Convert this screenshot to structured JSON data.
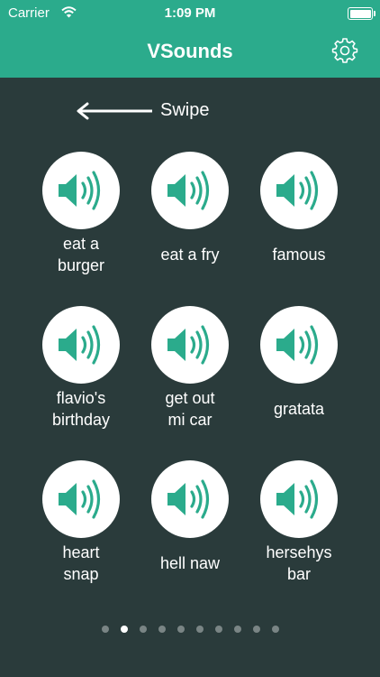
{
  "status_bar": {
    "carrier": "Carrier",
    "time": "1:09 PM"
  },
  "header": {
    "title": "VSounds",
    "settings_icon": "gear-icon"
  },
  "swipe_hint": {
    "label": "Swipe",
    "icon": "arrow-left-icon"
  },
  "sounds": [
    {
      "label_1": "eat a",
      "label_2": "burger"
    },
    {
      "label": "eat a fry"
    },
    {
      "label": "famous"
    },
    {
      "label_1": "flavio's",
      "label_2": "birthday"
    },
    {
      "label_1": "get out",
      "label_2": "mi car"
    },
    {
      "label": "gratata"
    },
    {
      "label_1": "heart",
      "label_2": "snap"
    },
    {
      "label": "hell naw"
    },
    {
      "label_1": "hersehys",
      "label_2": "bar"
    }
  ],
  "sound_icon": "speaker-icon",
  "pagination": {
    "total": 10,
    "current": 2
  },
  "colors": {
    "accent": "#2bab8c",
    "background": "#2a3b3b",
    "dot_inactive": "#7a8585"
  }
}
